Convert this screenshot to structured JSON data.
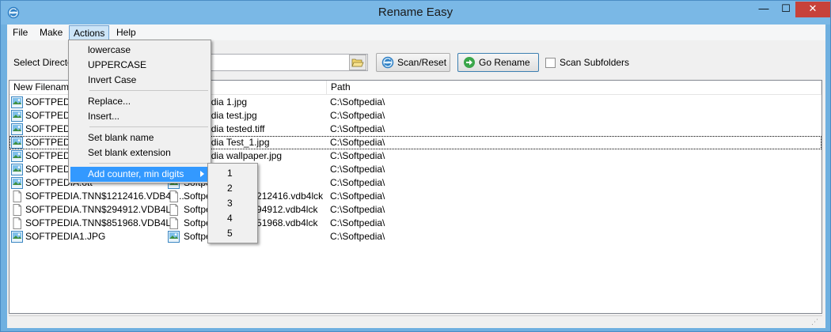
{
  "window": {
    "title": "Rename Easy",
    "minimize": "—",
    "maximize": "☐",
    "close": "✕"
  },
  "menubar": {
    "items": [
      "File",
      "Make",
      "Actions",
      "Help"
    ],
    "active": "Actions"
  },
  "toolbar": {
    "dir_label": "Select Directory",
    "dir_value": "",
    "scan_label": "Scan/Reset",
    "go_label": "Go Rename",
    "subfolders_label": "Scan Subfolders",
    "subfolders_checked": false
  },
  "list": {
    "columns": [
      "New Filename",
      "Filename",
      "Path"
    ],
    "rows": [
      {
        "new": "SOFTPEDIA",
        "old": "Softpedia 1.jpg",
        "path": "C:\\Softpedia\\",
        "icon": "image-file-icon"
      },
      {
        "new": "SOFTPEDIA",
        "old": "Softpedia test.jpg",
        "path": "C:\\Softpedia\\",
        "icon": "image-file-icon"
      },
      {
        "new": "SOFTPEDIA",
        "old": "Softpedia tested.tiff",
        "path": "C:\\Softpedia\\",
        "icon": "image-file-icon"
      },
      {
        "new": "SOFTPEDIA",
        "old": "Softpedia Test_1.jpg",
        "path": "C:\\Softpedia\\",
        "icon": "image-file-icon"
      },
      {
        "new": "SOFTPEDIA",
        "old": "Softpedia wallpaper.jpg",
        "path": "C:\\Softpedia\\",
        "icon": "image-file-icon"
      },
      {
        "new": "SOFTPEDIA",
        "old": "Softpedia",
        "path": "C:\\Softpedia\\",
        "icon": "image-file-icon"
      },
      {
        "new": "SOFTPEDIA.ott",
        "old": "Softpedia",
        "path": "C:\\Softpedia\\",
        "icon": "image-file-icon"
      },
      {
        "new": "SOFTPEDIA.TNN$1212416.VDB4L...",
        "old": "Softpedia.TNN$1212416.vdb4lck",
        "path": "C:\\Softpedia\\",
        "icon": "blank-file-icon"
      },
      {
        "new": "SOFTPEDIA.TNN$294912.VDB4L...",
        "old": "Softpedia.TNN$294912.vdb4lck",
        "path": "C:\\Softpedia\\",
        "icon": "blank-file-icon"
      },
      {
        "new": "SOFTPEDIA.TNN$851968.VDB4L...",
        "old": "Softpedia.TNN$851968.vdb4lck",
        "path": "C:\\Softpedia\\",
        "icon": "blank-file-icon"
      },
      {
        "new": "SOFTPEDIA1.JPG",
        "old": "Softpedia",
        "path": "C:\\Softpedia\\",
        "icon": "image-file-icon"
      }
    ],
    "focused_row": 3
  },
  "actions_menu": {
    "items": [
      {
        "label": "lowercase"
      },
      {
        "label": "UPPERCASE"
      },
      {
        "label": "Invert Case"
      },
      {
        "label": "Replace..."
      },
      {
        "label": "Insert..."
      },
      {
        "label": "Set blank name"
      },
      {
        "label": "Set blank extension"
      },
      {
        "label": "Add counter, min digits"
      }
    ],
    "highlighted": "Add counter, min digits"
  },
  "counter_submenu": {
    "items": [
      "1",
      "2",
      "3",
      "4",
      "5"
    ]
  },
  "colors": {
    "titlebar": "#7ab8e6",
    "highlight": "#3399ff",
    "close": "#c7423a"
  }
}
